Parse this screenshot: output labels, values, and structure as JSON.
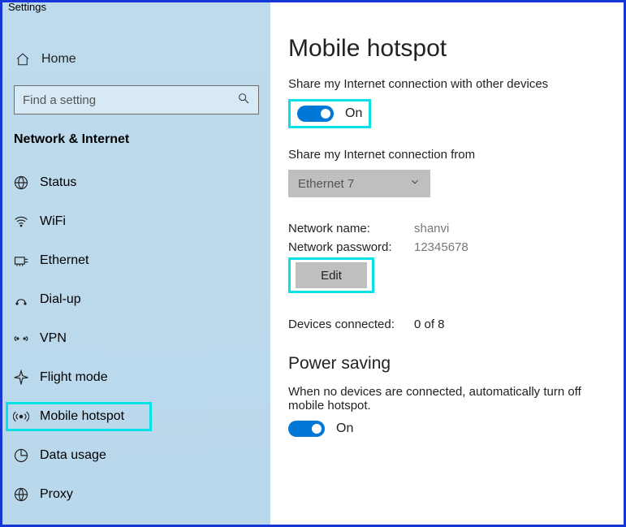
{
  "window_title": "Settings",
  "sidebar": {
    "home_label": "Home",
    "search_placeholder": "Find a setting",
    "category_title": "Network & Internet",
    "items": [
      {
        "label": "Status"
      },
      {
        "label": "WiFi"
      },
      {
        "label": "Ethernet"
      },
      {
        "label": "Dial-up"
      },
      {
        "label": "VPN"
      },
      {
        "label": "Flight mode"
      },
      {
        "label": "Mobile hotspot"
      },
      {
        "label": "Data usage"
      },
      {
        "label": "Proxy"
      }
    ]
  },
  "main": {
    "title": "Mobile hotspot",
    "share_desc": "Share my Internet connection with other devices",
    "share_toggle": "On",
    "from_label": "Share my Internet connection from",
    "from_value": "Ethernet 7",
    "net_name_label": "Network name:",
    "net_name_value": "shanvi",
    "net_pass_label": "Network password:",
    "net_pass_value": "12345678",
    "edit_label": "Edit",
    "devices_label": "Devices connected:",
    "devices_value": "0 of 8",
    "power_title": "Power saving",
    "power_desc": "When no devices are connected, automatically turn off mobile hotspot.",
    "power_toggle": "On"
  }
}
